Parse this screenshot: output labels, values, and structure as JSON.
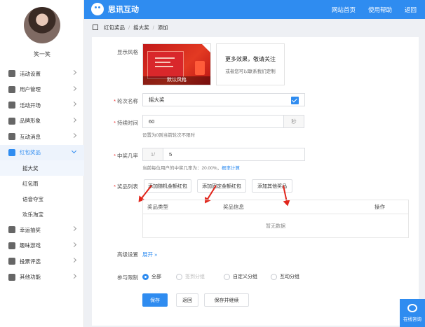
{
  "app": {
    "brand": "思讯互动"
  },
  "topnav": [
    "网站首页",
    "使用帮助",
    "返回"
  ],
  "user": {
    "name": "笑一笑"
  },
  "sidebar": {
    "items": [
      {
        "label": "活动设置",
        "icon": "sliders-icon"
      },
      {
        "label": "用户管理",
        "icon": "user-icon"
      },
      {
        "label": "活动开场",
        "icon": "send-icon"
      },
      {
        "label": "品牌形象",
        "icon": "badge-icon"
      },
      {
        "label": "互动消息",
        "icon": "message-icon"
      },
      {
        "label": "红包奖品",
        "icon": "gift-icon"
      },
      {
        "label": "幸运抽奖",
        "icon": "grid-icon"
      },
      {
        "label": "趣味游戏",
        "icon": "game-icon"
      },
      {
        "label": "投票评选",
        "icon": "star-icon"
      },
      {
        "label": "其他功能",
        "icon": "more-icon"
      }
    ],
    "subitems": [
      "摇大奖",
      "红包雨",
      "语音夺宝",
      "欢乐淘宝"
    ]
  },
  "breadcrumb": [
    "红包奖品",
    "摇大奖",
    "添加"
  ],
  "form": {
    "style_label": "显示风格",
    "style_default": "默认风格",
    "style_more_title": "更多效果，敬请关注",
    "style_more_sub": "或者您可以联系我们定制",
    "rounds_label": "轮次名称",
    "rounds_value": "摇大奖",
    "duration_label": "持续时间",
    "duration_value": "60",
    "duration_unit": "秒",
    "duration_hint": "设置为0则当前轮次不限时",
    "rate_label": "中奖几率",
    "rate_prefix": "1/",
    "rate_value": "5",
    "rate_hint": "当前每位用户的中奖几率为：20.00%，",
    "rate_link": "概率计算",
    "prize_label": "奖品列表",
    "prize_buttons": [
      "添加随机金额红包",
      "添加固定金额红包",
      "添加其他奖品"
    ],
    "table_headers": [
      "奖品类型",
      "奖品信息",
      "操作"
    ],
    "table_empty": "暂无数据",
    "advanced_label": "高级设置",
    "advanced_toggle": "展开",
    "limit_label": "参与限制",
    "limit_options": [
      {
        "label": "全部",
        "selected": true,
        "disabled": false
      },
      {
        "label": "签到分组",
        "selected": false,
        "disabled": true
      },
      {
        "label": "自定义分组",
        "selected": false,
        "disabled": false
      },
      {
        "label": "互动分组",
        "selected": false,
        "disabled": false
      }
    ],
    "actions": [
      "保存",
      "返回",
      "保存并继续"
    ]
  },
  "consult": {
    "label": "在线咨询"
  },
  "colors": {
    "primary": "#2f8cf0",
    "arrow": "#e1251b"
  }
}
